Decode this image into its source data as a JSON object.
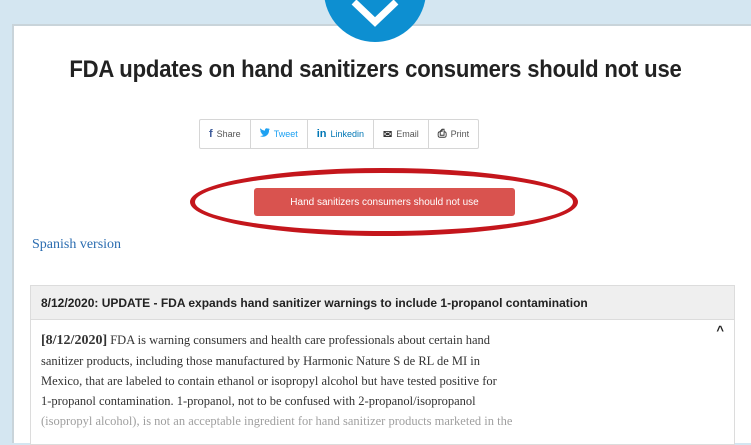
{
  "title": "FDA updates on hand sanitizers consumers should not use",
  "share": [
    {
      "icon": "facebook-icon",
      "glyph": "f",
      "label": "Share"
    },
    {
      "icon": "twitter-icon",
      "glyph": "🐦",
      "label": "Tweet"
    },
    {
      "icon": "linkedin-icon",
      "glyph": "in",
      "label": "Linkedin"
    },
    {
      "icon": "email-icon",
      "glyph": "✉",
      "label": "Email"
    },
    {
      "icon": "print-icon",
      "glyph": "⎙",
      "label": "Print"
    }
  ],
  "main_button": "Hand sanitizers consumers should not use",
  "spanish_link": "Spanish version",
  "accordion": {
    "heading": "8/12/2020: UPDATE - FDA expands hand sanitizer warnings to include 1-propanol contamination",
    "toggle": "^",
    "date": "[8/12/2020]",
    "lines": [
      " FDA is warning consumers and health care professionals about certain hand",
      "sanitizer products, including those manufactured by Harmonic Nature S de RL de MI in",
      "Mexico, that are labeled to contain ethanol or isopropyl alcohol but have tested positive for",
      "1-propanol contamination. 1-propanol, not to be confused with 2-propanol/isopropanol",
      "(isopropyl alcohol), is not an acceptable ingredient for hand sanitizer products marketed in the"
    ]
  },
  "colors": {
    "background": "#d4e6f1",
    "accent_blue": "#0d8fd1",
    "button_red": "#d9534f",
    "oval_red": "#c4161c",
    "link": "#2a6cb0"
  }
}
